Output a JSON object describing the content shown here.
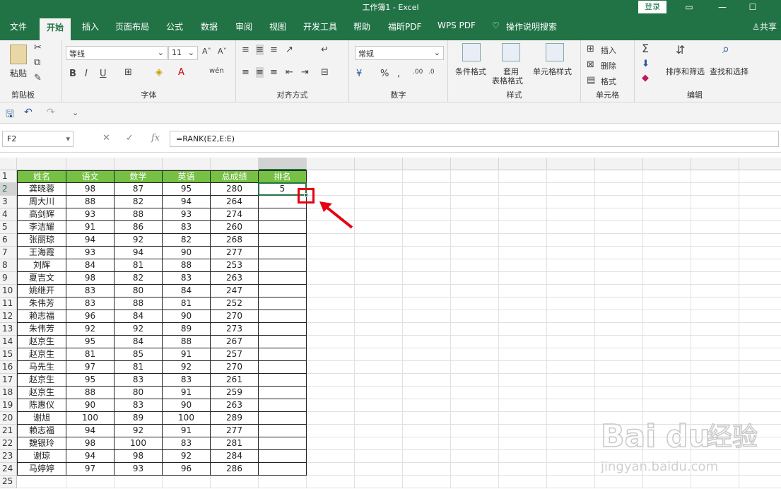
{
  "window": {
    "title": "工作簿1 - Excel",
    "login": "登录"
  },
  "menu": {
    "tabs": [
      "文件",
      "开始",
      "插入",
      "页面布局",
      "公式",
      "数据",
      "审阅",
      "视图",
      "开发工具",
      "帮助",
      "福昕PDF",
      "WPS PDF",
      "操作说明搜索"
    ],
    "active": "开始",
    "share": "共享"
  },
  "ribbon": {
    "clipboard": {
      "paste": "粘贴",
      "label": "剪贴板"
    },
    "font": {
      "name": "等线",
      "size": "11",
      "label": "字体"
    },
    "align": {
      "label": "对齐方式"
    },
    "number": {
      "format": "常规",
      "label": "数字"
    },
    "styles": {
      "cond": "条件格式",
      "table": "套用",
      "table2": "表格格式",
      "cell": "单元格样式",
      "label": "样式"
    },
    "cells": {
      "insert": "插入",
      "delete": "删除",
      "format": "格式",
      "label": "单元格"
    },
    "editing": {
      "sort": "排序和筛选",
      "find": "查找和选择",
      "label": "编辑"
    }
  },
  "formula_bar": {
    "name_box": "F2",
    "formula": "=RANK(E2,E:E)"
  },
  "sheet": {
    "columns": [
      "A",
      "B",
      "C",
      "D",
      "E",
      "F",
      "G",
      "H",
      "I",
      "J",
      "K",
      "L",
      "M",
      "N",
      "O",
      "P"
    ],
    "selected_column": "F",
    "selected_row": 2,
    "header": [
      "姓名",
      "语文",
      "数学",
      "英语",
      "总成绩",
      "排名"
    ],
    "rows": [
      [
        "龚晓蓉",
        "98",
        "87",
        "95",
        "280",
        "5"
      ],
      [
        "周大川",
        "88",
        "82",
        "94",
        "264",
        ""
      ],
      [
        "高剑辉",
        "93",
        "88",
        "93",
        "274",
        ""
      ],
      [
        "李洁耀",
        "91",
        "86",
        "83",
        "260",
        ""
      ],
      [
        "张丽琼",
        "94",
        "92",
        "82",
        "268",
        ""
      ],
      [
        "王海霞",
        "93",
        "94",
        "90",
        "277",
        ""
      ],
      [
        "刘辉",
        "84",
        "81",
        "88",
        "253",
        ""
      ],
      [
        "夏吉文",
        "98",
        "82",
        "83",
        "263",
        ""
      ],
      [
        "姚继开",
        "83",
        "80",
        "84",
        "247",
        ""
      ],
      [
        "朱伟芳",
        "83",
        "88",
        "81",
        "252",
        ""
      ],
      [
        "赖志福",
        "96",
        "84",
        "90",
        "270",
        ""
      ],
      [
        "朱伟芳",
        "92",
        "92",
        "89",
        "273",
        ""
      ],
      [
        "赵京生",
        "95",
        "84",
        "88",
        "267",
        ""
      ],
      [
        "赵京生",
        "81",
        "85",
        "91",
        "257",
        ""
      ],
      [
        "马先生",
        "97",
        "81",
        "92",
        "270",
        ""
      ],
      [
        "赵京生",
        "95",
        "83",
        "83",
        "261",
        ""
      ],
      [
        "赵京生",
        "88",
        "80",
        "91",
        "259",
        ""
      ],
      [
        "陈惠仪",
        "90",
        "83",
        "90",
        "263",
        ""
      ],
      [
        "谢旭",
        "100",
        "89",
        "100",
        "289",
        ""
      ],
      [
        "赖志福",
        "94",
        "92",
        "91",
        "277",
        ""
      ],
      [
        "魏银玲",
        "98",
        "100",
        "83",
        "281",
        ""
      ],
      [
        "谢琼",
        "94",
        "98",
        "92",
        "284",
        ""
      ],
      [
        "马婷婷",
        "97",
        "93",
        "96",
        "286",
        ""
      ]
    ],
    "extra_row_numbers": [
      25
    ]
  },
  "colors": {
    "excel_green": "#217346",
    "header_fill": "#76c043",
    "highlight": "#e60012"
  }
}
